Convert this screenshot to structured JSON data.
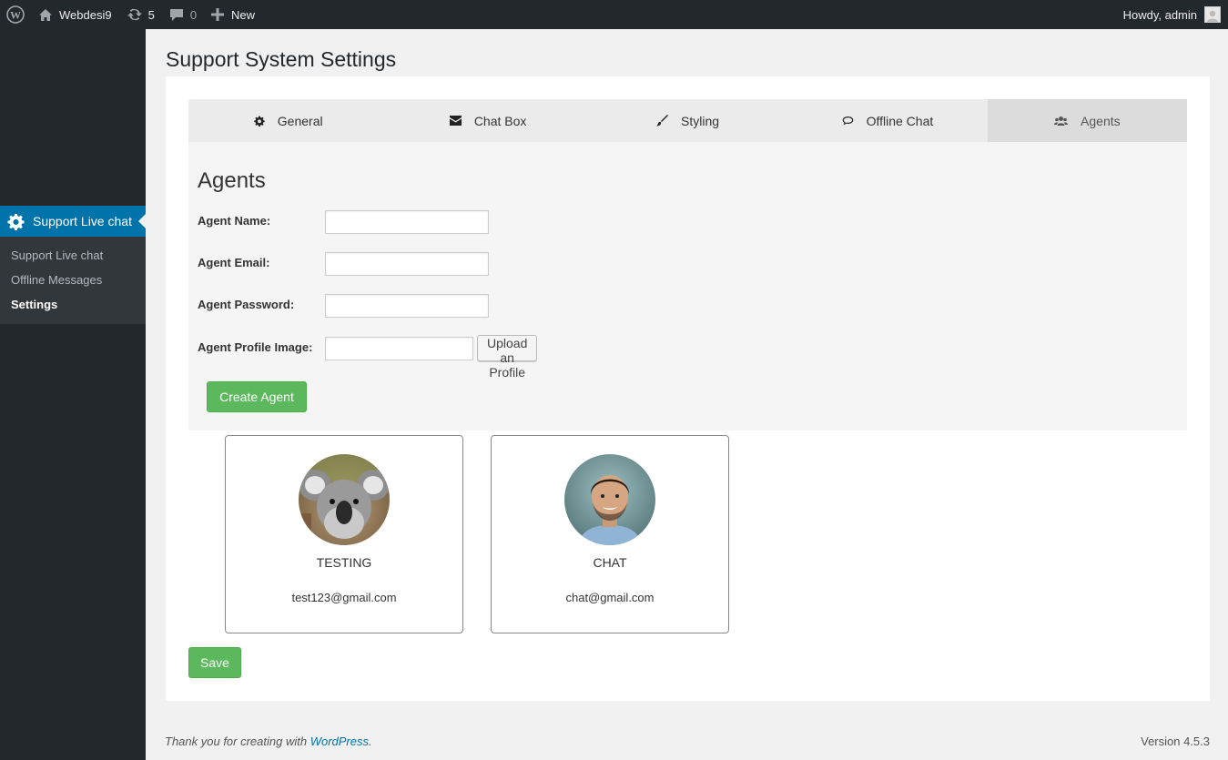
{
  "adminbar": {
    "site_name": "Webdesi9",
    "updates_count": "5",
    "comments_count": "0",
    "new_label": "New",
    "greeting": "Howdy, admin"
  },
  "sidebar": {
    "menu_title": "Support Live chat",
    "items": [
      {
        "label": "Support Live chat"
      },
      {
        "label": "Offline Messages"
      },
      {
        "label": "Settings"
      }
    ]
  },
  "page": {
    "title": "Support System Settings"
  },
  "tabs": [
    {
      "label": "General",
      "icon": "gear-icon"
    },
    {
      "label": "Chat Box",
      "icon": "envelope-icon"
    },
    {
      "label": "Styling",
      "icon": "brush-icon"
    },
    {
      "label": "Offline Chat",
      "icon": "comment-icon"
    },
    {
      "label": "Agents",
      "icon": "users-icon"
    }
  ],
  "form": {
    "heading": "Agents",
    "agent_name_label": "Agent Name:",
    "agent_name_value": "",
    "agent_email_label": "Agent Email:",
    "agent_email_value": "",
    "agent_password_label": "Agent Password:",
    "agent_password_value": "",
    "agent_image_label": "Agent Profile Image:",
    "agent_image_value": "",
    "upload_label": "Upload an Profile",
    "create_label": "Create Agent"
  },
  "agents": [
    {
      "name": "TESTING",
      "email": "test123@gmail.com",
      "avatar": "koala"
    },
    {
      "name": "CHAT",
      "email": "chat@gmail.com",
      "avatar": "man"
    }
  ],
  "save_label": "Save",
  "footer": {
    "thanks_prefix": "Thank you for creating with ",
    "link": "WordPress",
    "suffix": ".",
    "version": "Version 4.5.3"
  },
  "colors": {
    "accent": "#0073aa",
    "success": "#5cb85c",
    "admin_bg": "#23282d"
  }
}
